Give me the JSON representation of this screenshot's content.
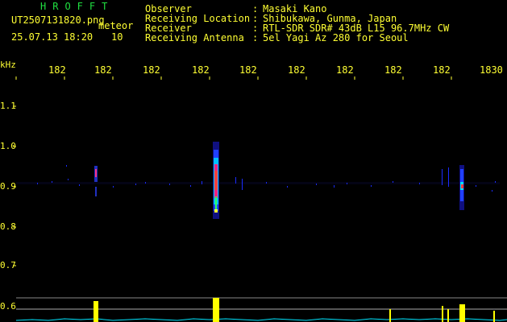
{
  "app": {
    "title": "HROFFT"
  },
  "file": {
    "name": "UT2507131820.png",
    "type": "meteor",
    "datetime": "25.07.13 18:20",
    "count": "10"
  },
  "info": {
    "labels": [
      "Observer",
      "Receiving Location",
      "Receiver",
      "Receiving Antenna"
    ],
    "sep": [
      ":",
      ":",
      ":",
      ":"
    ],
    "values": [
      "Masaki Kano",
      "Shibukawa, Gunma, Japan",
      "RTL-SDR SDR# 43dB L15 96.7MHz CW",
      "5el Yagi Az 280 for Seoul"
    ]
  },
  "axis": {
    "unit": "kHz",
    "x_ticks": [
      "182",
      "182",
      "182",
      "182",
      "182",
      "182",
      "182",
      "182",
      "182",
      "1830"
    ],
    "y_ticks": [
      "1.1",
      "1.0",
      "0.9",
      "0.8",
      "0.7",
      "0.6"
    ]
  },
  "colors": {
    "background": "#000000",
    "text": "#ffff33",
    "title": "#20e040",
    "spectrum": "#00e5ff",
    "peaks": "#ffff00"
  }
}
